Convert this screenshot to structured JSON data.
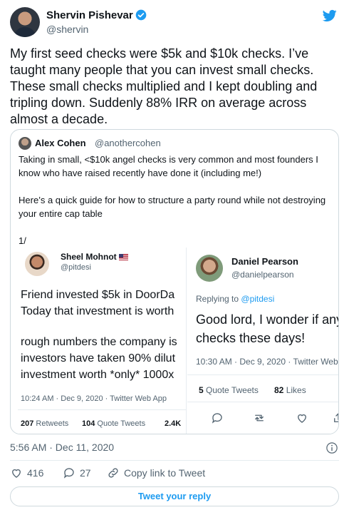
{
  "author": {
    "name": "Shervin Pishevar",
    "handle": "@shervin",
    "verified": true
  },
  "tweet": {
    "text": "My first seed checks were $5k and $10k checks. I’ve taught many people that you can invest small checks. These small checks multiplied and I kept doubling and tripling down. Suddenly 88% IRR on average across almost a decade.",
    "timestamp": "5:56 AM · Dec 11, 2020"
  },
  "quote": {
    "name": "Alex Cohen",
    "handle": "@anothercohen",
    "text": "Taking in small, <$10k angel checks is very common and most founders I know who have raised recently have done it (including me!)\n\nHere’s a quick guide for how to structure a party round while not destroying your entire cap table\n\n1/",
    "left_shot": {
      "name": "Sheel Mohnot",
      "handle": "@pitdesi",
      "line1": "Friend invested $5k in DoorDa",
      "line2": "Today that investment is worth",
      "line3": "rough numbers the company is",
      "line4": "investors have taken 90% dilut",
      "line5": "investment worth *only* 1000x",
      "meta": "10:24 AM · Dec 9, 2020 · Twitter Web App",
      "retweets_num": "207",
      "retweets_label": "Retweets",
      "quotes_num": "104",
      "quotes_label": "Quote Tweets",
      "likes_num": "2.4K"
    },
    "right_shot": {
      "name": "Daniel Pearson",
      "handle": "@danielpearson",
      "replying_label": "Replying to",
      "replying_handle": "@pitdesi",
      "line1": "Good lord, I wonder if any f",
      "line2": "checks these days!",
      "meta": "10:30 AM · Dec 9, 2020 · Twitter Web",
      "quotes_num": "5",
      "quotes_label": "Quote Tweets",
      "likes_num": "82",
      "likes_label": "Likes"
    }
  },
  "actions": {
    "likes_count": "416",
    "replies_count": "27",
    "copy_link_label": "Copy link to Tweet",
    "reply_button_label": "Tweet your reply"
  },
  "colors": {
    "accent": "#1d9bf0",
    "text": "#0f1419",
    "muted": "#536471",
    "border": "#cfd9de"
  }
}
